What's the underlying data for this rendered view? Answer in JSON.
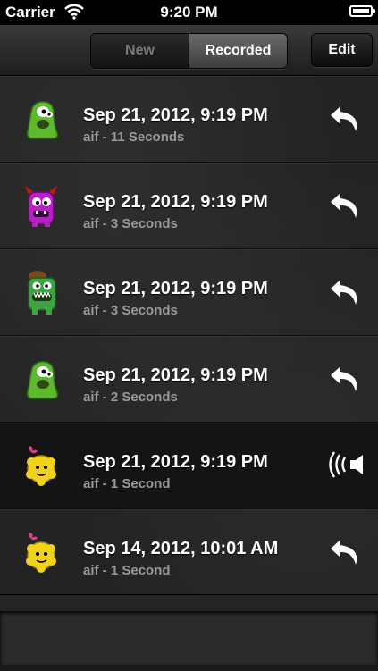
{
  "status_bar": {
    "carrier": "Carrier",
    "time": "9:20 PM"
  },
  "nav": {
    "segments": [
      "New",
      "Recorded"
    ],
    "selected_segment": "Recorded",
    "edit_label": "Edit"
  },
  "recordings": [
    {
      "title": "Sep 21, 2012, 9:19 PM",
      "subtitle": "aif - 11 Seconds",
      "avatar": "green-monster-icon",
      "action": "replay-icon"
    },
    {
      "title": "Sep 21, 2012, 9:19 PM",
      "subtitle": "aif - 3 Seconds",
      "avatar": "purple-devil-monster-icon",
      "action": "replay-icon"
    },
    {
      "title": "Sep 21, 2012, 9:19 PM",
      "subtitle": "aif - 3 Seconds",
      "avatar": "green-hat-monster-icon",
      "action": "replay-icon"
    },
    {
      "title": "Sep 21, 2012, 9:19 PM",
      "subtitle": "aif - 2 Seconds",
      "avatar": "green-monster-icon",
      "action": "replay-icon"
    },
    {
      "title": "Sep 21, 2012, 9:19 PM",
      "subtitle": "aif - 1 Second",
      "avatar": "yellow-flower-monster-icon",
      "action": "speaker-playing-icon"
    },
    {
      "title": "Sep 14, 2012, 10:01 AM",
      "subtitle": "aif - 1 Second",
      "avatar": "yellow-flower-monster-icon",
      "action": "replay-icon"
    }
  ],
  "colors": {
    "background": "#232323",
    "title_text": "#ffffff",
    "subtitle_text": "#9a9a9a",
    "green_monster": "#5fb82e",
    "purple_monster": "#b81fc7",
    "yellow_monster": "#f2d21c"
  }
}
